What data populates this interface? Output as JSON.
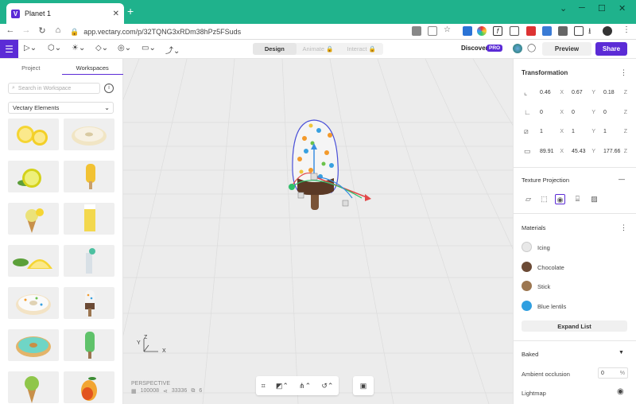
{
  "browser": {
    "tab_title": "Planet 1",
    "tab_close": "✕",
    "new_tab": "+",
    "url": "app.vectary.com/p/32TQNG3xRDm38hPz5FSuds",
    "window_controls": [
      "⌄",
      "─",
      "☐",
      "✕"
    ]
  },
  "toolbar": {
    "modes": [
      "Design",
      "Animate",
      "Interact"
    ],
    "active_mode": "Design",
    "discover_label": "Discover",
    "pro_badge": "PRO",
    "preview_label": "Preview",
    "share_label": "Share"
  },
  "left_panel": {
    "tabs": [
      "Project",
      "Workspaces"
    ],
    "active_tab": "Workspaces",
    "search_placeholder": "Search in Workspace",
    "library_select": "Vectary Elements",
    "items": [
      "lemon-slices",
      "donut-lemon",
      "lemon-half",
      "popsicle-yellow",
      "icecream-cone-lemon",
      "juice-carton",
      "lemon-wedges",
      "cocktail-glass",
      "donut-sprinkles",
      "popsicle-sprinkles",
      "donut-mint",
      "popsicle-green",
      "icecream-cone-green",
      "mango"
    ]
  },
  "viewport": {
    "view_label": "PERSPECTIVE",
    "stats": [
      "100008",
      "33336",
      "6"
    ],
    "axis_y": "Y",
    "axis_x": "X",
    "axis_z": "Z"
  },
  "right_panel": {
    "transformation_title": "Transformation",
    "position": {
      "x": "0.46",
      "y": "0.67",
      "z": "0.18"
    },
    "rotation": {
      "x": "0",
      "y": "0",
      "z": "0"
    },
    "scale": {
      "x": "1",
      "y": "1",
      "z": "1"
    },
    "size": {
      "x": "89.91",
      "y": "45.43",
      "z": "177.66"
    },
    "axis_labels": [
      "X",
      "Y",
      "Z"
    ],
    "texture_projection_title": "Texture Projection",
    "collapse_symbol": "—",
    "materials_title": "Materials",
    "materials": [
      {
        "name": "Icing",
        "color": "#e8e8e8"
      },
      {
        "name": "Chocolate",
        "color": "#6b4a35"
      },
      {
        "name": "Stick",
        "color": "#9c7650"
      },
      {
        "name": "Blue lentils",
        "color": "#2f9fe0"
      }
    ],
    "expand_label": "Expand List",
    "baked_title": "Baked",
    "ambient_label": "Ambient occlusion",
    "ambient_value": "0",
    "ambient_unit": "%",
    "lightmap_label": "Lightmap"
  },
  "colors": {
    "brand": "#5b2bd6",
    "browser": "#1fb28c",
    "viewport": "#ececec"
  }
}
